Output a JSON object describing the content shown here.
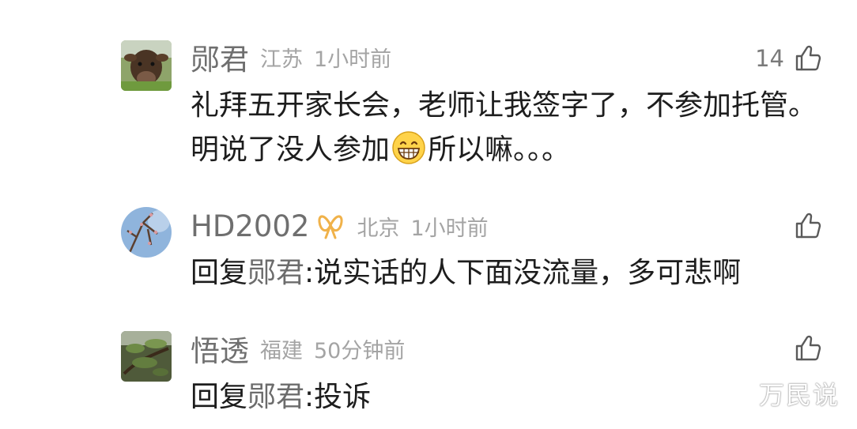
{
  "comments": [
    {
      "username": "郧君",
      "location": "江苏",
      "time": "1小时前",
      "likes": "14",
      "text_before": "礼拜五开家长会，老师让我签字了，不参加托管。明说了没人参加",
      "emoji": "grinning-face-emoji",
      "text_after": "所以嘛。。。"
    },
    {
      "username": "HD2002",
      "badge": "ribbon-badge-icon",
      "location": "北京",
      "time": "1小时前",
      "reply_prefix": "回复",
      "mention": "郧君",
      "separator": ":",
      "reply_text": "说实话的人下面没流量，多可悲啊"
    },
    {
      "username": "悟透",
      "location": "福建",
      "time": "50分钟前",
      "reply_prefix": "回复",
      "mention": "郧君",
      "separator": ":",
      "reply_text": "投诉"
    }
  ],
  "watermark": "万民说",
  "colors": {
    "username": "#6f6f6f",
    "meta": "#a4a4a4",
    "text": "#1d1d1d",
    "badge": "#f0b24a"
  }
}
